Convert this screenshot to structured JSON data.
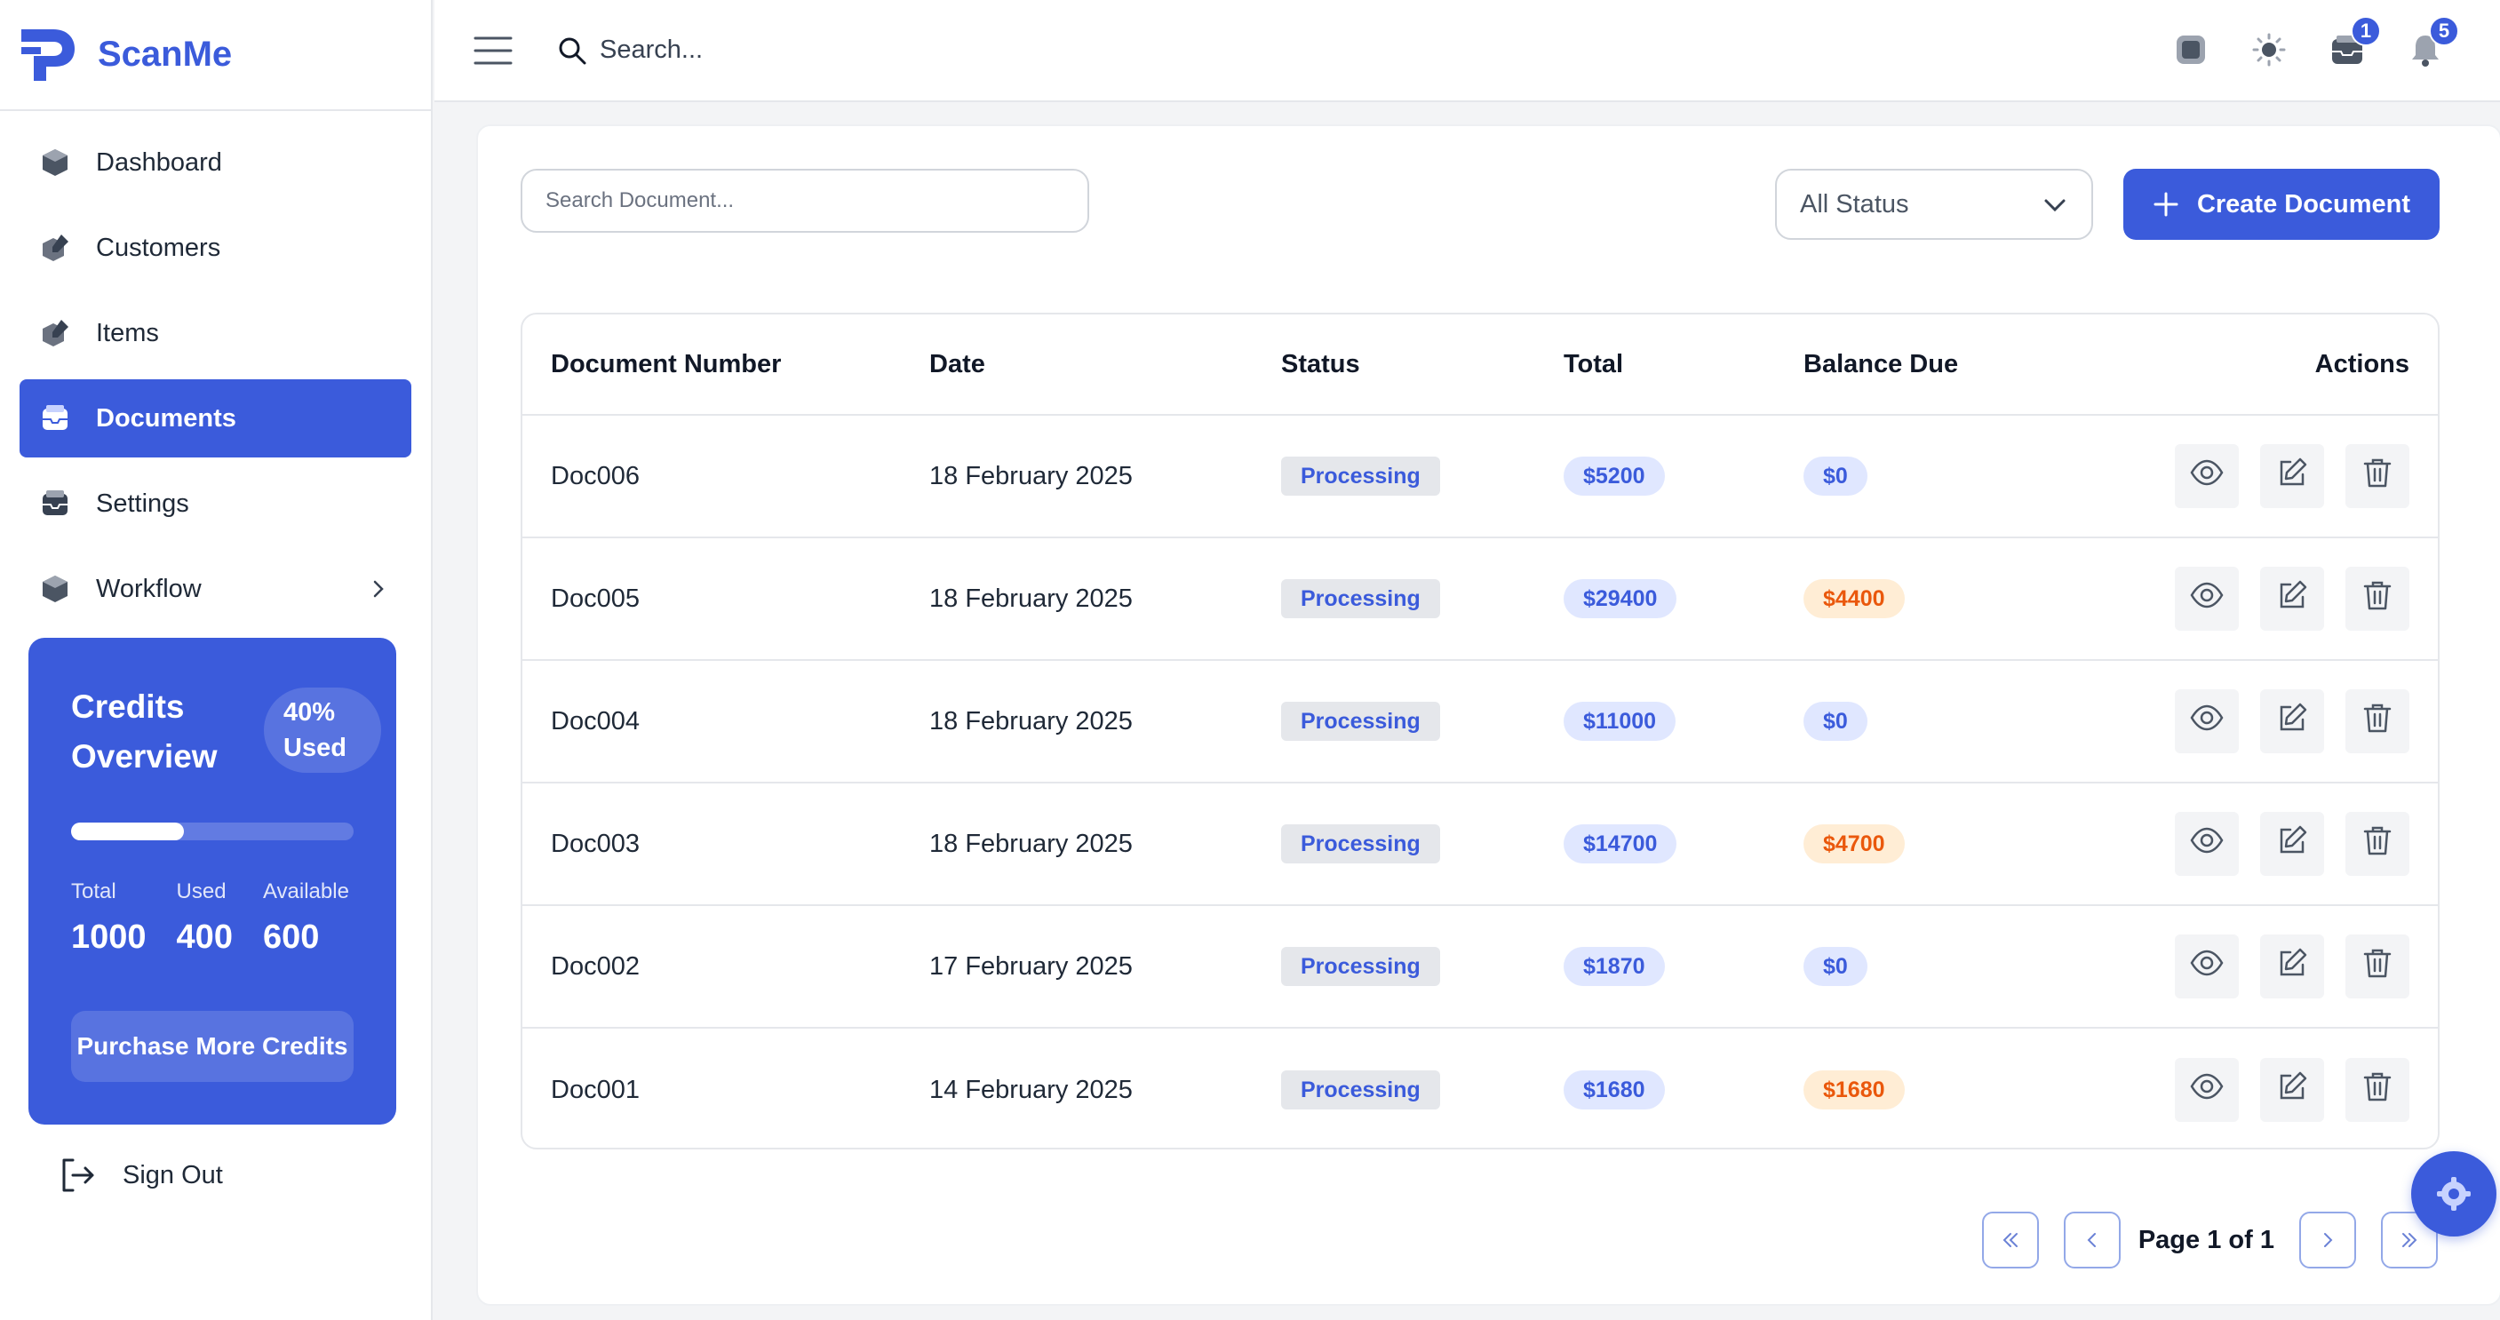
{
  "brand": {
    "name": "ScanMe"
  },
  "sidebar": {
    "items": [
      {
        "label": "Dashboard",
        "icon": "cube-icon"
      },
      {
        "label": "Customers",
        "icon": "edit-cube-icon"
      },
      {
        "label": "Items",
        "icon": "edit-cube-icon"
      },
      {
        "label": "Documents",
        "icon": "inbox-icon",
        "active": true
      },
      {
        "label": "Settings",
        "icon": "inbox-icon"
      },
      {
        "label": "Workflow",
        "icon": "cube-icon",
        "has_submenu": true
      }
    ],
    "sign_out_label": "Sign Out"
  },
  "credits": {
    "title": "Credits Overview",
    "used_percent_label": "40%",
    "used_word": "Used",
    "used_fraction": 0.4,
    "stats": [
      {
        "label": "Total",
        "value": "1000"
      },
      {
        "label": "Used",
        "value": "400"
      },
      {
        "label": "Available",
        "value": "600"
      }
    ],
    "purchase_label": "Purchase More Credits"
  },
  "topbar": {
    "search_placeholder": "Search...",
    "mail_badge": "1",
    "notifications_badge": "5"
  },
  "toolbar": {
    "doc_search_placeholder": "Search Document...",
    "status_filter": "All Status",
    "create_label": "Create Document"
  },
  "table": {
    "headers": {
      "doc_number": "Document Number",
      "date": "Date",
      "status": "Status",
      "total": "Total",
      "balance": "Balance Due",
      "actions": "Actions"
    },
    "rows": [
      {
        "doc": "Doc006",
        "date": "18 February 2025",
        "status": "Processing",
        "total": "$5200",
        "balance": "$0",
        "balance_due": false
      },
      {
        "doc": "Doc005",
        "date": "18 February 2025",
        "status": "Processing",
        "total": "$29400",
        "balance": "$4400",
        "balance_due": true
      },
      {
        "doc": "Doc004",
        "date": "18 February 2025",
        "status": "Processing",
        "total": "$11000",
        "balance": "$0",
        "balance_due": false
      },
      {
        "doc": "Doc003",
        "date": "18 February 2025",
        "status": "Processing",
        "total": "$14700",
        "balance": "$4700",
        "balance_due": true
      },
      {
        "doc": "Doc002",
        "date": "17 February 2025",
        "status": "Processing",
        "total": "$1870",
        "balance": "$0",
        "balance_due": false
      },
      {
        "doc": "Doc001",
        "date": "14 February 2025",
        "status": "Processing",
        "total": "$1680",
        "balance": "$1680",
        "balance_due": true
      }
    ]
  },
  "pagination": {
    "page_prefix": "Page",
    "current": "1",
    "of_word": "of",
    "total": "1"
  },
  "colors": {
    "accent": "#3b5bdb",
    "orange": "#ea580c"
  }
}
